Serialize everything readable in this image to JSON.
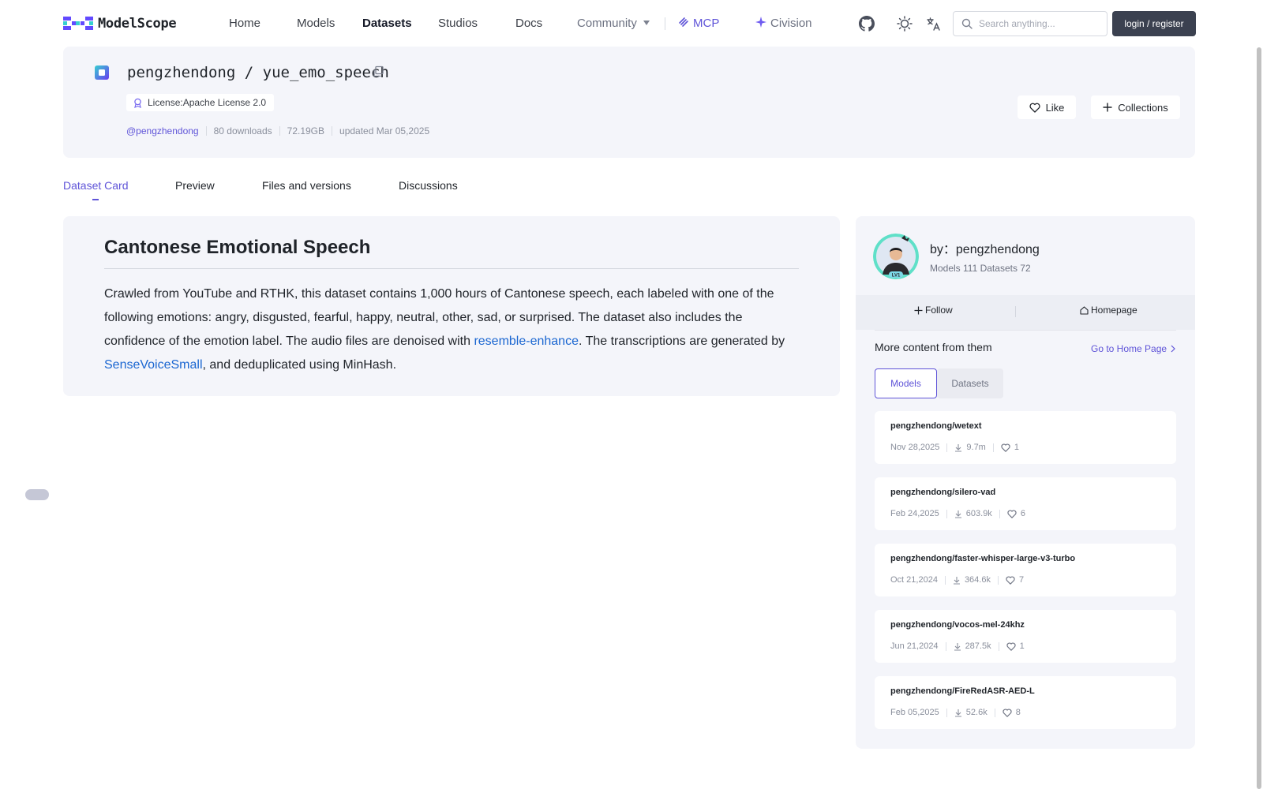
{
  "nav": {
    "brand": "ModelScope",
    "items": [
      {
        "label": "Home",
        "state": "normal"
      },
      {
        "label": "Models",
        "state": "normal"
      },
      {
        "label": "Datasets",
        "state": "active"
      },
      {
        "label": "Studios",
        "state": "normal"
      },
      {
        "label": "Docs",
        "state": "normal"
      },
      {
        "label": "Community",
        "state": "dropdown"
      },
      {
        "label": "MCP",
        "state": "accent"
      },
      {
        "label": "Civision",
        "state": "normal"
      }
    ],
    "search_placeholder": "Search anything...",
    "login_label": "login / register",
    "icons": [
      "github-icon",
      "theme-sun-icon",
      "language-switch-icon"
    ]
  },
  "header": {
    "owner": "pengzhendong",
    "separator": "/",
    "dataset": "yue_emo_speech",
    "license": "License:Apache License 2.0",
    "author_handle": "@pengzhendong",
    "downloads": "80 downloads",
    "size": "72.19GB",
    "updated": "updated Mar 05,2025",
    "like_label": "Like",
    "collections_label": "Collections"
  },
  "tabs": [
    {
      "label": "Dataset Card",
      "active": true
    },
    {
      "label": "Preview",
      "active": false
    },
    {
      "label": "Files and versions",
      "active": false
    },
    {
      "label": "Discussions",
      "active": false
    }
  ],
  "card": {
    "title": "Cantonese Emotional Speech",
    "text1": "Crawled from YouTube and RTHK, this dataset contains 1,000 hours of Cantonese speech, each labeled with one of the following emotions: angry, disgusted, fearful, happy, neutral, other, sad, or surprised. The dataset also includes the confidence of the emotion label. The audio files are denoised with ",
    "link1": "resemble-enhance",
    "text2": ". The transcriptions are generated by ",
    "link2": "SenseVoiceSmall",
    "text3": ", and deduplicated using MinHash."
  },
  "sidebar": {
    "by_label": "by：pengzhendong",
    "avatar_badge": "LV1",
    "counts": "Models 111  Datasets 72",
    "follow_label": "Follow",
    "homepage_label": "Homepage",
    "more_title": "More content from them",
    "goto_label": "Go to Home Page",
    "seg_models": "Models",
    "seg_datasets": "Datasets",
    "models": [
      {
        "name": "pengzhendong/wetext",
        "date": "Nov 28,2025",
        "downloads": "9.7m",
        "likes": "1"
      },
      {
        "name": "pengzhendong/silero-vad",
        "date": "Feb 24,2025",
        "downloads": "603.9k",
        "likes": "6"
      },
      {
        "name": "pengzhendong/faster-whisper-large-v3-turbo",
        "date": "Oct 21,2024",
        "downloads": "364.6k",
        "likes": "7"
      },
      {
        "name": "pengzhendong/vocos-mel-24khz",
        "date": "Jun 21,2024",
        "downloads": "287.5k",
        "likes": "1"
      },
      {
        "name": "pengzhendong/FireRedASR-AED-L",
        "date": "Feb 05,2025",
        "downloads": "52.6k",
        "likes": "8"
      }
    ]
  },
  "colors": {
    "accent": "#5f54d8",
    "link": "#1a66d1",
    "card_bg": "#f4f5fa",
    "login_bg": "#3b4150"
  }
}
